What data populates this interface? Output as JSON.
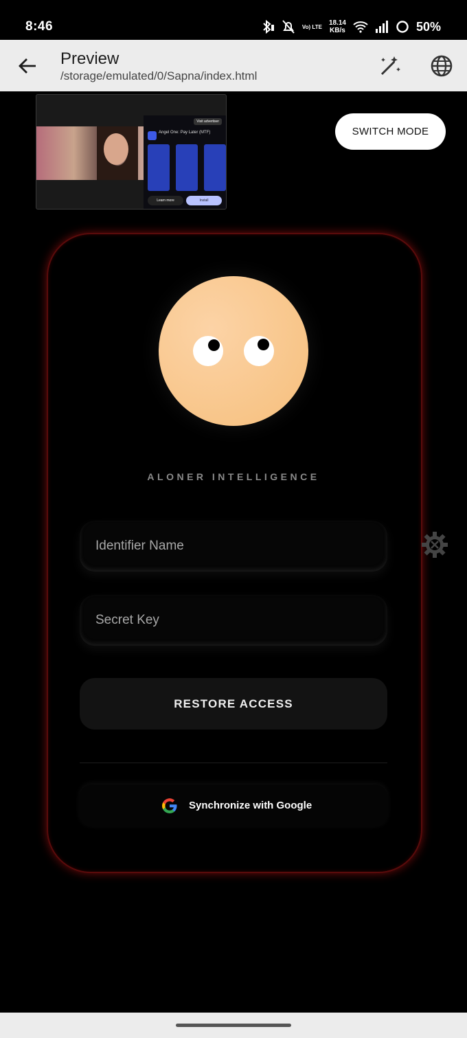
{
  "status_bar": {
    "time": "8:46",
    "speed_value": "18.14",
    "speed_unit": "KB/s",
    "volte": "Vo) LTE",
    "battery": "50%"
  },
  "app_bar": {
    "title": "Preview",
    "path": "/storage/emulated/0/Sapna/index.html",
    "icons": [
      "back-arrow-icon",
      "magic-wand-icon",
      "globe-icon"
    ]
  },
  "ad": {
    "visit_label": "Visit advertiser",
    "app_name": "Angel One: Pay Later (MTF)",
    "learn_more": "Learn more",
    "install": "Install"
  },
  "switch_mode_label": "SWITCH MODE",
  "login": {
    "brand": "ALONER INTELLIGENCE",
    "identifier_placeholder": "Identifier Name",
    "secret_placeholder": "Secret Key",
    "restore_label": "RESTORE ACCESS",
    "google_label": "Synchronize with Google"
  },
  "colors": {
    "background": "#000000",
    "face": "#f8c68a",
    "card_glow": "#c81414",
    "app_bar": "#ececec"
  }
}
